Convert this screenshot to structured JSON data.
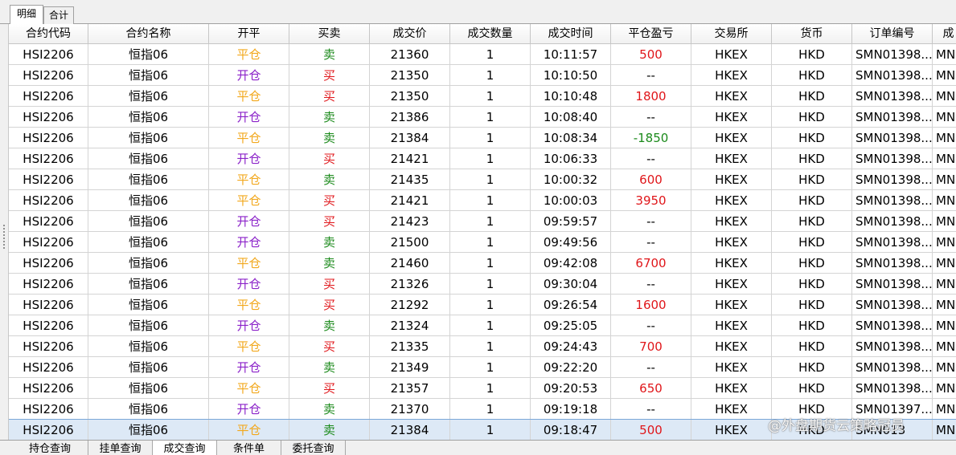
{
  "top_tabs": [
    "明细",
    "合计"
  ],
  "columns": [
    "合约代码",
    "合约名称",
    "开平",
    "买卖",
    "成交价",
    "成交数量",
    "成交时间",
    "平仓盈亏",
    "交易所",
    "货币",
    "订单编号",
    "成"
  ],
  "colors": {
    "open": "#8b22c9",
    "close": "#f2a81d",
    "buy": "#e0161a",
    "sell": "#1b8a1b",
    "profit": "#e0161a",
    "loss": "#1b8a1b",
    "selected_row": "#dde9f6"
  },
  "rows": [
    {
      "code": "HSI2206",
      "name": "恒指06",
      "oc": "平仓",
      "bs": "卖",
      "price": "21360",
      "qty": "1",
      "time": "10:11:57",
      "pnl": "500",
      "exch": "HKEX",
      "cur": "HKD",
      "order": "SMN01398...",
      "extra": "MN"
    },
    {
      "code": "HSI2206",
      "name": "恒指06",
      "oc": "开仓",
      "bs": "买",
      "price": "21350",
      "qty": "1",
      "time": "10:10:50",
      "pnl": "--",
      "exch": "HKEX",
      "cur": "HKD",
      "order": "SMN01398...",
      "extra": "MN"
    },
    {
      "code": "HSI2206",
      "name": "恒指06",
      "oc": "平仓",
      "bs": "买",
      "price": "21350",
      "qty": "1",
      "time": "10:10:48",
      "pnl": "1800",
      "exch": "HKEX",
      "cur": "HKD",
      "order": "SMN01398...",
      "extra": "MN"
    },
    {
      "code": "HSI2206",
      "name": "恒指06",
      "oc": "开仓",
      "bs": "卖",
      "price": "21386",
      "qty": "1",
      "time": "10:08:40",
      "pnl": "--",
      "exch": "HKEX",
      "cur": "HKD",
      "order": "SMN01398...",
      "extra": "MN"
    },
    {
      "code": "HSI2206",
      "name": "恒指06",
      "oc": "平仓",
      "bs": "卖",
      "price": "21384",
      "qty": "1",
      "time": "10:08:34",
      "pnl": "-1850",
      "exch": "HKEX",
      "cur": "HKD",
      "order": "SMN01398...",
      "extra": "MN"
    },
    {
      "code": "HSI2206",
      "name": "恒指06",
      "oc": "开仓",
      "bs": "买",
      "price": "21421",
      "qty": "1",
      "time": "10:06:33",
      "pnl": "--",
      "exch": "HKEX",
      "cur": "HKD",
      "order": "SMN01398...",
      "extra": "MN"
    },
    {
      "code": "HSI2206",
      "name": "恒指06",
      "oc": "平仓",
      "bs": "卖",
      "price": "21435",
      "qty": "1",
      "time": "10:00:32",
      "pnl": "600",
      "exch": "HKEX",
      "cur": "HKD",
      "order": "SMN01398...",
      "extra": "MN"
    },
    {
      "code": "HSI2206",
      "name": "恒指06",
      "oc": "平仓",
      "bs": "买",
      "price": "21421",
      "qty": "1",
      "time": "10:00:03",
      "pnl": "3950",
      "exch": "HKEX",
      "cur": "HKD",
      "order": "SMN01398...",
      "extra": "MN"
    },
    {
      "code": "HSI2206",
      "name": "恒指06",
      "oc": "开仓",
      "bs": "买",
      "price": "21423",
      "qty": "1",
      "time": "09:59:57",
      "pnl": "--",
      "exch": "HKEX",
      "cur": "HKD",
      "order": "SMN01398...",
      "extra": "MN"
    },
    {
      "code": "HSI2206",
      "name": "恒指06",
      "oc": "开仓",
      "bs": "卖",
      "price": "21500",
      "qty": "1",
      "time": "09:49:56",
      "pnl": "--",
      "exch": "HKEX",
      "cur": "HKD",
      "order": "SMN01398...",
      "extra": "MN"
    },
    {
      "code": "HSI2206",
      "name": "恒指06",
      "oc": "平仓",
      "bs": "卖",
      "price": "21460",
      "qty": "1",
      "time": "09:42:08",
      "pnl": "6700",
      "exch": "HKEX",
      "cur": "HKD",
      "order": "SMN01398...",
      "extra": "MN"
    },
    {
      "code": "HSI2206",
      "name": "恒指06",
      "oc": "开仓",
      "bs": "买",
      "price": "21326",
      "qty": "1",
      "time": "09:30:04",
      "pnl": "--",
      "exch": "HKEX",
      "cur": "HKD",
      "order": "SMN01398...",
      "extra": "MN"
    },
    {
      "code": "HSI2206",
      "name": "恒指06",
      "oc": "平仓",
      "bs": "买",
      "price": "21292",
      "qty": "1",
      "time": "09:26:54",
      "pnl": "1600",
      "exch": "HKEX",
      "cur": "HKD",
      "order": "SMN01398...",
      "extra": "MN"
    },
    {
      "code": "HSI2206",
      "name": "恒指06",
      "oc": "开仓",
      "bs": "卖",
      "price": "21324",
      "qty": "1",
      "time": "09:25:05",
      "pnl": "--",
      "exch": "HKEX",
      "cur": "HKD",
      "order": "SMN01398...",
      "extra": "MN"
    },
    {
      "code": "HSI2206",
      "name": "恒指06",
      "oc": "平仓",
      "bs": "买",
      "price": "21335",
      "qty": "1",
      "time": "09:24:43",
      "pnl": "700",
      "exch": "HKEX",
      "cur": "HKD",
      "order": "SMN01398...",
      "extra": "MN"
    },
    {
      "code": "HSI2206",
      "name": "恒指06",
      "oc": "开仓",
      "bs": "卖",
      "price": "21349",
      "qty": "1",
      "time": "09:22:20",
      "pnl": "--",
      "exch": "HKEX",
      "cur": "HKD",
      "order": "SMN01398...",
      "extra": "MN"
    },
    {
      "code": "HSI2206",
      "name": "恒指06",
      "oc": "平仓",
      "bs": "买",
      "price": "21357",
      "qty": "1",
      "time": "09:20:53",
      "pnl": "650",
      "exch": "HKEX",
      "cur": "HKD",
      "order": "SMN01398...",
      "extra": "MN"
    },
    {
      "code": "HSI2206",
      "name": "恒指06",
      "oc": "开仓",
      "bs": "卖",
      "price": "21370",
      "qty": "1",
      "time": "09:19:18",
      "pnl": "--",
      "exch": "HKEX",
      "cur": "HKD",
      "order": "SMN01397...",
      "extra": "MN"
    },
    {
      "code": "HSI2206",
      "name": "恒指06",
      "oc": "平仓",
      "bs": "卖",
      "price": "21384",
      "qty": "1",
      "time": "09:18:47",
      "pnl": "500",
      "exch": "HKEX",
      "cur": "HKD",
      "order": "SMN013",
      "extra": "MN",
      "selected": true
    }
  ],
  "watermark": "@外盘期货云策略冠员",
  "bottom_tabs": [
    "持仓查询",
    "挂单查询",
    "成交查询",
    "条件单",
    "委托查询"
  ],
  "active_bottom_tab": 2
}
